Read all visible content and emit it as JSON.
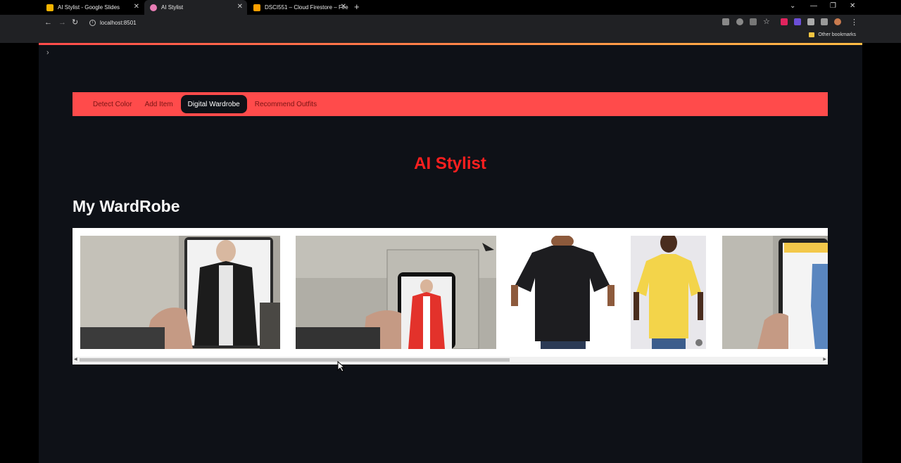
{
  "browser": {
    "tabs": [
      {
        "title": "AI Stylist - Google Slides",
        "favicon_color": "#f6b400",
        "active": false
      },
      {
        "title": "AI Stylist",
        "favicon_color": "#e97db5",
        "active": true
      },
      {
        "title": "DSCI551 – Cloud Firestore – Fire",
        "favicon_color": "#ffa000",
        "active": false
      }
    ],
    "new_tab_icon": "+",
    "url": "localhost:8501",
    "bookmark_folder": "Other bookmarks"
  },
  "app": {
    "nav": {
      "items": [
        {
          "label": "Detect Color",
          "active": false
        },
        {
          "label": "Add Item",
          "active": false
        },
        {
          "label": "Digital Wardrobe",
          "active": true
        },
        {
          "label": "Recommend Outfits",
          "active": false
        }
      ],
      "accent_color": "#ff4b4b"
    },
    "title": "AI Stylist",
    "section_heading": "My WardRobe",
    "wardrobe_items": [
      {
        "name": "black leather jacket"
      },
      {
        "name": "red jacket"
      },
      {
        "name": "black t-shirt"
      },
      {
        "name": "yellow t-shirt"
      },
      {
        "name": "blue jeans"
      }
    ],
    "scroll_fraction": 0.58
  }
}
